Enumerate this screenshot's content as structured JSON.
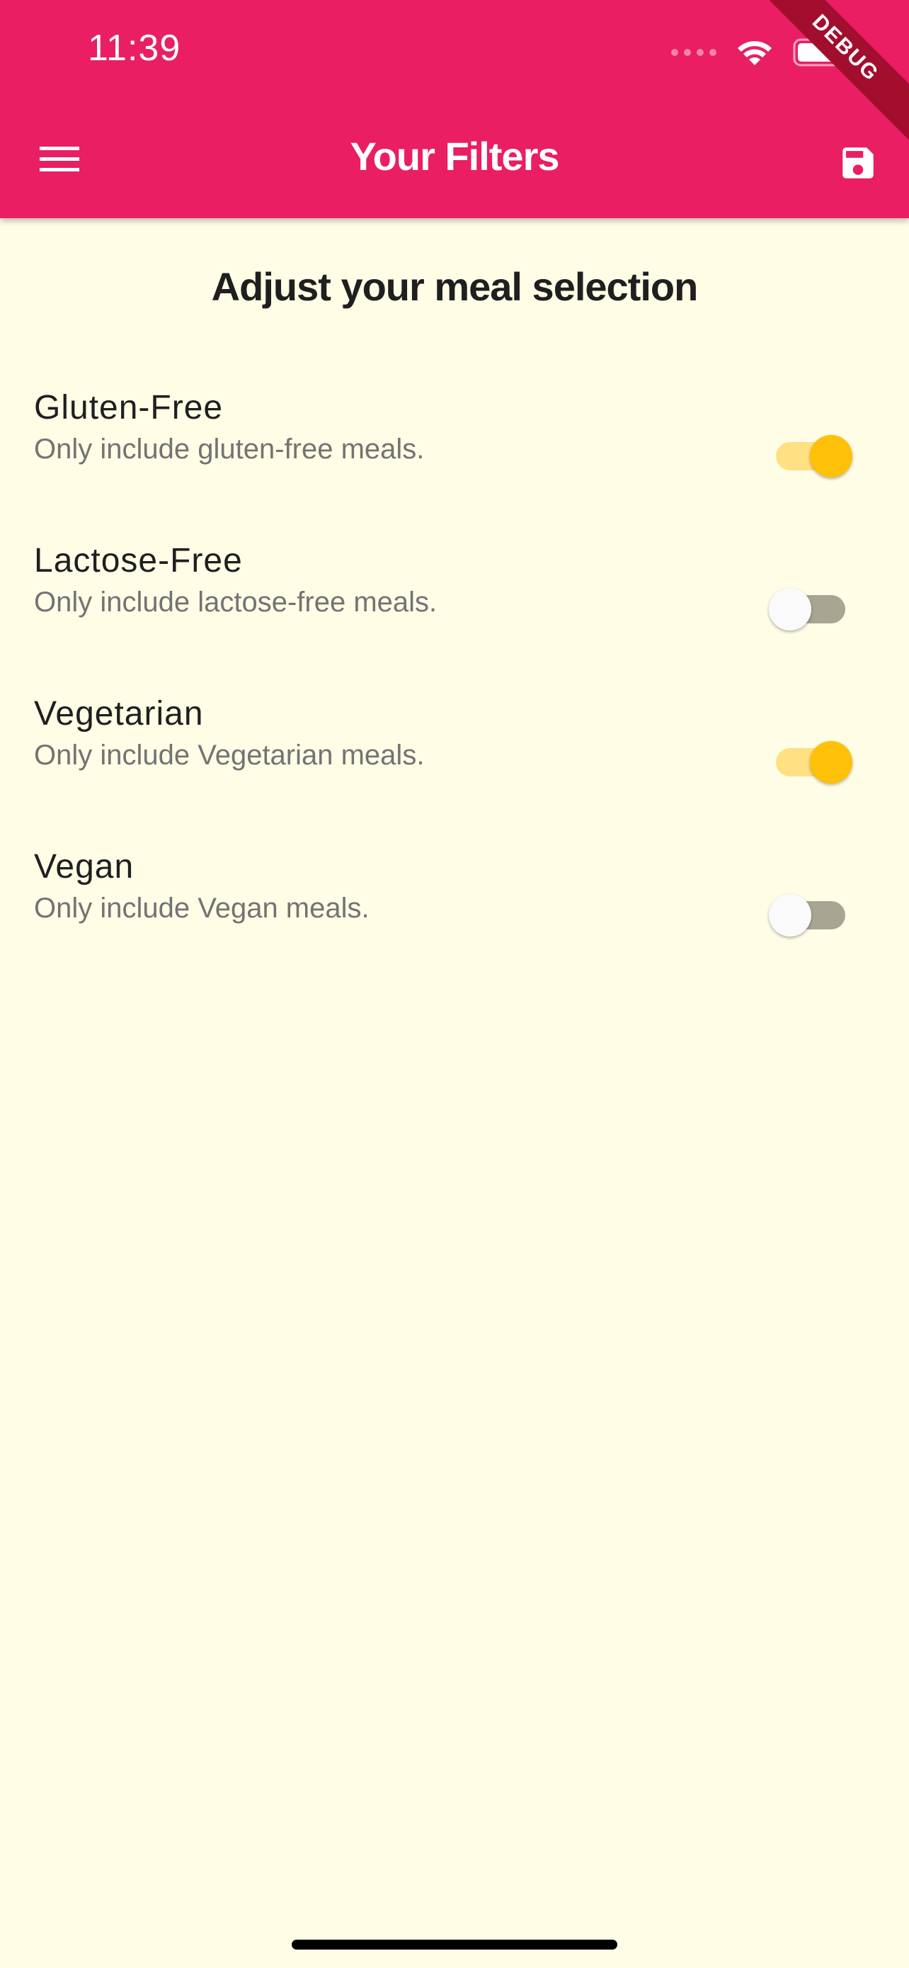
{
  "status_bar": {
    "time": "11:39"
  },
  "debug_banner": {
    "label": "DEBUG"
  },
  "app_bar": {
    "title": "Your Filters",
    "menu_icon": "menu-icon",
    "save_icon": "save-icon"
  },
  "page": {
    "heading": "Adjust your meal selection"
  },
  "filters": [
    {
      "title": "Gluten-Free",
      "subtitle": "Only include gluten-free meals.",
      "enabled": true
    },
    {
      "title": "Lactose-Free",
      "subtitle": "Only include lactose-free meals.",
      "enabled": false
    },
    {
      "title": "Vegetarian",
      "subtitle": "Only include Vegetarian meals.",
      "enabled": true
    },
    {
      "title": "Vegan",
      "subtitle": "Only include Vegan meals.",
      "enabled": false
    }
  ],
  "colors": {
    "app_bar": "#E91E63",
    "background": "#FFFDE6",
    "switch_on": "#FFC107",
    "switch_on_track": "#FFE082",
    "switch_off_track": "#A8A593"
  }
}
